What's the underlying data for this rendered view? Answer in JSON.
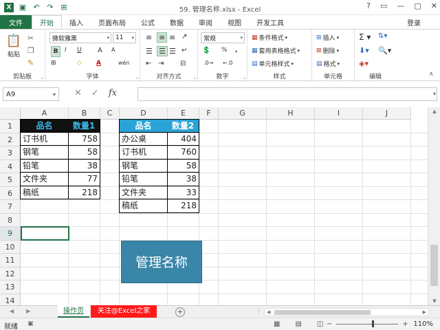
{
  "window": {
    "title": "59. 管理名称.xlsx - Excel",
    "login": "登录"
  },
  "colors": {
    "accent": "#217346",
    "header_black": "#111111",
    "header_blue": "#2aa3d6",
    "shape_fill": "#3a86a8",
    "red_tab": "#ff1a1a"
  },
  "tabs": {
    "file": "文件",
    "items": [
      "开始",
      "插入",
      "页面布局",
      "公式",
      "数据",
      "审阅",
      "视图",
      "开发工具"
    ]
  },
  "ribbon": {
    "clipboard": {
      "label": "剪贴板",
      "paste": "粘贴"
    },
    "font": {
      "label": "字体",
      "name": "微软雅黑",
      "size": "11",
      "bold": "B",
      "italic": "I",
      "underline": "U",
      "grow": "A",
      "shrink": "A",
      "border": "⊞",
      "fill": "◇",
      "color": "A",
      "phonetic": "wén"
    },
    "alignment": {
      "label": "对齐方式"
    },
    "number": {
      "label": "数字",
      "format": "常规",
      "percent": "%",
      "comma": ","
    },
    "styles": {
      "label": "样式",
      "conditional": "条件格式",
      "table": "套用表格格式",
      "cell": "单元格样式"
    },
    "cells": {
      "label": "单元格",
      "insert": "插入",
      "delete": "删除",
      "format": "格式"
    },
    "editing": {
      "label": "编辑"
    }
  },
  "formula_bar": {
    "name_box": "A9",
    "cancel": "✕",
    "enter": "✓",
    "fx": "fx",
    "value": ""
  },
  "columns": [
    "A",
    "B",
    "C",
    "D",
    "E",
    "F",
    "G",
    "H",
    "I",
    "J"
  ],
  "rows": [
    "1",
    "2",
    "3",
    "4",
    "5",
    "6",
    "7",
    "8",
    "9",
    "10",
    "11",
    "12",
    "13",
    "14"
  ],
  "table1": {
    "headers": [
      "品名",
      "数量1"
    ],
    "rows": [
      [
        "订书机",
        "758"
      ],
      [
        "钢笔",
        "58"
      ],
      [
        "铅笔",
        "38"
      ],
      [
        "文件夹",
        "77"
      ],
      [
        "稿纸",
        "218"
      ]
    ]
  },
  "table2": {
    "headers": [
      "品名",
      "数量2"
    ],
    "rows": [
      [
        "办公桌",
        "404"
      ],
      [
        "订书机",
        "760"
      ],
      [
        "钢笔",
        "58"
      ],
      [
        "铅笔",
        "38"
      ],
      [
        "文件夹",
        "33"
      ],
      [
        "稿纸",
        "218"
      ]
    ]
  },
  "shape_button": {
    "label": "管理名称"
  },
  "sheets": {
    "active": "操作页",
    "other": "关注@Excel之家",
    "add": "+"
  },
  "status": {
    "mode": "就绪",
    "zoom": "110%",
    "minus": "−",
    "plus": "+"
  }
}
